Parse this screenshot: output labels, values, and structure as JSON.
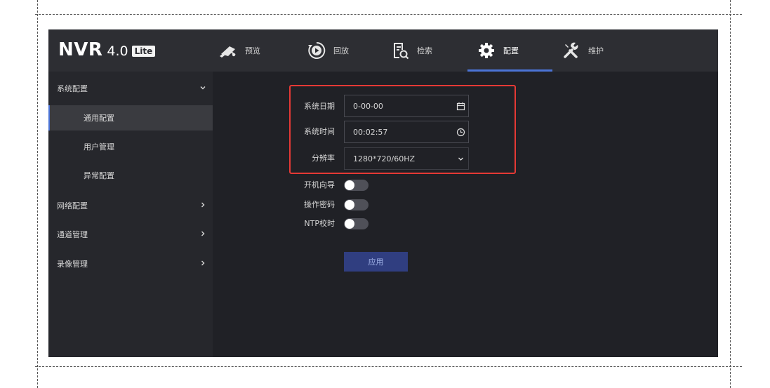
{
  "app": {
    "brand": {
      "name": "NVR",
      "version": "4.0",
      "badge": "Lite"
    },
    "nav": [
      {
        "key": "preview",
        "label": "预览",
        "icon": "camera-icon"
      },
      {
        "key": "playback",
        "label": "回放",
        "icon": "playback-icon"
      },
      {
        "key": "search",
        "label": "检索",
        "icon": "search-document-icon"
      },
      {
        "key": "config",
        "label": "配置",
        "icon": "gear-icon",
        "active": true
      },
      {
        "key": "maintain",
        "label": "维护",
        "icon": "tools-icon"
      }
    ]
  },
  "sidebar": {
    "items": [
      {
        "label": "系统配置",
        "level": "top",
        "expanded": true
      },
      {
        "label": "通用配置",
        "level": "sub",
        "active": true
      },
      {
        "label": "用户管理",
        "level": "sub"
      },
      {
        "label": "异常配置",
        "level": "sub"
      },
      {
        "label": "网络配置",
        "level": "top"
      },
      {
        "label": "通道管理",
        "level": "top"
      },
      {
        "label": "录像管理",
        "level": "top"
      }
    ]
  },
  "form": {
    "system_date": {
      "label": "系统日期",
      "value": "0-00-00"
    },
    "system_time": {
      "label": "系统时间",
      "value": "00:02:57"
    },
    "resolution": {
      "label": "分辨率",
      "value": "1280*720/60HZ"
    },
    "boot_wizard": {
      "label": "开机向导",
      "enabled": false
    },
    "op_password": {
      "label": "操作密码",
      "enabled": false
    },
    "ntp_sync": {
      "label": "NTP校时",
      "enabled": false
    },
    "apply_label": "应用"
  },
  "colors": {
    "accent": "#4b74d6",
    "highlight_box": "#e53935",
    "topbar": "#2d2e33",
    "sidebar": "#26272c",
    "content": "#202126"
  }
}
